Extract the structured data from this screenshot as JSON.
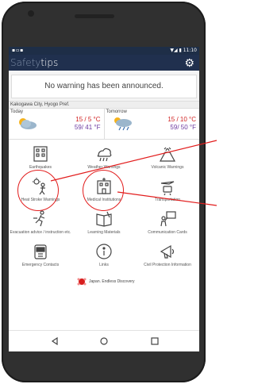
{
  "statusbar": {
    "left_icons": "▪▫▪",
    "time": "11:10",
    "signal": "▼◢ ▮"
  },
  "appbar": {
    "title_light": "Safety",
    "title_bold": "tips",
    "settings_icon": "gear-icon"
  },
  "warning": {
    "text": "No warning has been announced."
  },
  "weather": {
    "location": "Kakogawa City, Hyogo Pref.",
    "today": {
      "label": "Today",
      "hi": "15",
      "hi_unit": "5 °C",
      "lo": "59",
      "lo_unit": "41 °F"
    },
    "tomorrow": {
      "label": "Tomorrow",
      "hi": "15",
      "hi_unit": "10 °C",
      "lo": "59",
      "lo_unit": "50 °F"
    }
  },
  "menu": {
    "items": [
      {
        "label": "Earthquakes",
        "icon": "earthquake-icon"
      },
      {
        "label": "Weather Warnings",
        "icon": "weather-warning-icon"
      },
      {
        "label": "Volcanic Warnings",
        "icon": "volcano-icon"
      },
      {
        "label": "Heat Stroke Warnings",
        "icon": "heat-stroke-icon"
      },
      {
        "label": "Medical Institutions",
        "icon": "hospital-icon"
      },
      {
        "label": "Transportation",
        "icon": "transportation-icon"
      },
      {
        "label": "Evacuation advice / instruction etc.",
        "icon": "evacuation-icon"
      },
      {
        "label": "Learning Materials",
        "icon": "book-icon"
      },
      {
        "label": "Communication Cards",
        "icon": "communication-card-icon"
      },
      {
        "label": "Emergency Contacts",
        "icon": "sos-icon"
      },
      {
        "label": "Links",
        "icon": "info-icon"
      },
      {
        "label": "Civil Protection Information",
        "icon": "megaphone-icon"
      }
    ]
  },
  "footer": {
    "logo_text": "Japan. Endless Discovery"
  },
  "navbar": {
    "back": "back-icon",
    "home": "home-icon",
    "recent": "recent-apps-icon"
  },
  "colors": {
    "appbar": "#20304e",
    "annotation": "#e21d1d",
    "temp_hi": "#d01f1f",
    "temp_lo": "#6c3aa0"
  }
}
